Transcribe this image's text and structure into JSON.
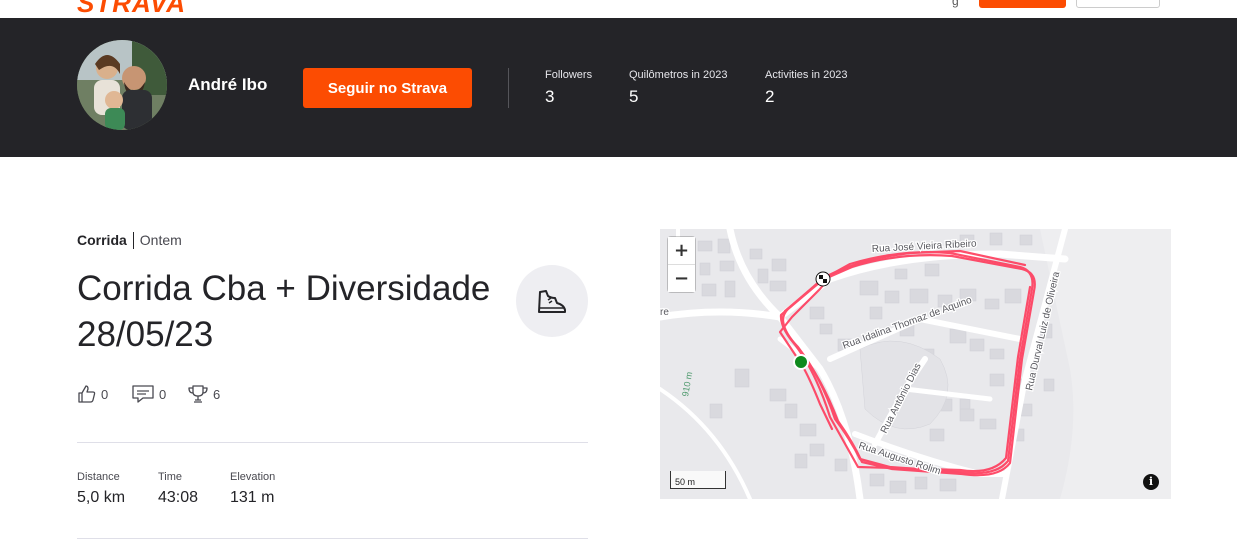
{
  "nav": {
    "logo": "STRAVA"
  },
  "athlete": {
    "name": "André Ibo",
    "follow_label": "Seguir no Strava",
    "stats": [
      {
        "label": "Followers",
        "value": "3"
      },
      {
        "label": "Quilômetros in 2023",
        "value": "5"
      },
      {
        "label": "Activities in 2023",
        "value": "2"
      }
    ]
  },
  "activity": {
    "sport": "Corrida",
    "date": "Ontem",
    "title": "Corrida Cba + Diversidade 28/05/23",
    "sport_icon": "running-shoe-icon",
    "kudos": "0",
    "comments": "0",
    "achievements": "6",
    "metrics": [
      {
        "label": "Distance",
        "value": "5,0 km"
      },
      {
        "label": "Time",
        "value": "43:08"
      },
      {
        "label": "Elevation",
        "value": "131 m"
      }
    ]
  },
  "map": {
    "streets": {
      "jose_vieira": "Rua José Vieira Ribeiro",
      "idalina": "Rua Idalina Thomaz de Aquino",
      "antonio_dias": "Rua Antônio Dias",
      "augusto_rolim": "Rua Augusto Rolim",
      "oliveira": "Rua Durval Luiz de Oliveira",
      "re": "re",
      "contour": "910 m"
    },
    "zoom_in": "+",
    "zoom_out": "−",
    "scale": "50 m",
    "info": "i",
    "route_color": "#ff3b5b",
    "start_color": "#0f8a1e"
  },
  "colors": {
    "brand": "#fc4c02",
    "header_bg": "#242428"
  }
}
